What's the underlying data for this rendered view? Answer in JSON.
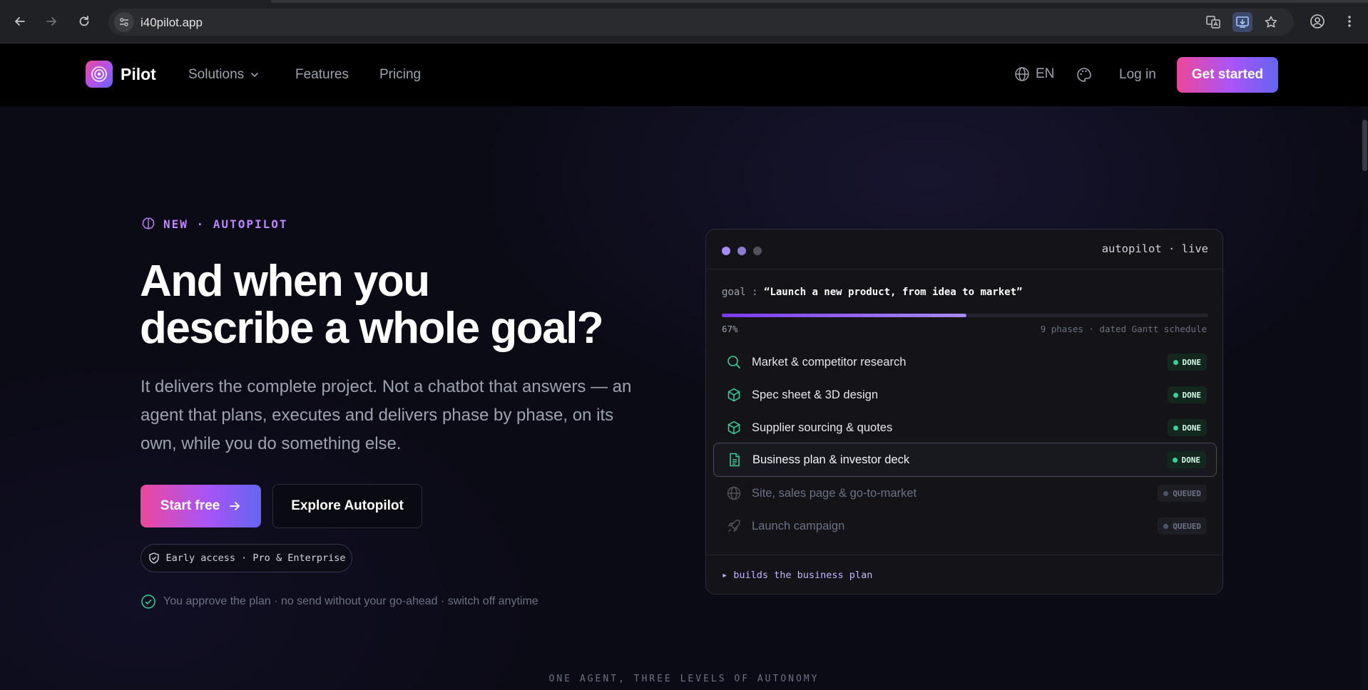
{
  "browser": {
    "url": "i40pilot.app"
  },
  "header": {
    "brand": "Pilot",
    "nav": [
      {
        "label": "Solutions"
      },
      {
        "label": "Features"
      },
      {
        "label": "Pricing"
      }
    ],
    "language": "EN",
    "login": "Log in",
    "cta": "Get started"
  },
  "hero": {
    "badge": "NEW · AUTOPILOT",
    "headline_line1": "And when you",
    "headline_line2": "describe a whole goal?",
    "subtext": "It delivers the complete project. Not a chatbot that answers — an agent that plans, executes and delivers phase by phase, on its own, while you do something else.",
    "primary_button": "Start free",
    "secondary_button": "Explore Autopilot",
    "access_pill": "Early access · Pro & Enterprise",
    "approve_note": "You approve the plan · no send without your go-ahead · switch off anytime",
    "levels_heading": "ONE AGENT, THREE LEVELS OF AUTONOMY"
  },
  "panel": {
    "status": "autopilot · live",
    "goal_label": "goal :",
    "goal_text": "“Launch a new product, from idea to market”",
    "progress_percent": 67,
    "progress_label": "67%",
    "progress_meta": "9 phases · dated Gantt schedule",
    "tasks": [
      {
        "label": "Market & competitor research",
        "status": "DONE",
        "icon": "search-icon"
      },
      {
        "label": "Spec sheet & 3D design",
        "status": "DONE",
        "icon": "cube-icon"
      },
      {
        "label": "Supplier sourcing & quotes",
        "status": "DONE",
        "icon": "cube-icon"
      },
      {
        "label": "Business plan & investor deck",
        "status": "DONE",
        "icon": "document-icon"
      },
      {
        "label": "Site, sales page & go-to-market",
        "status": "QUEUED",
        "icon": "globe-icon"
      },
      {
        "label": "Launch campaign",
        "status": "QUEUED",
        "icon": "rocket-icon"
      }
    ],
    "footer": "▸ builds the business plan"
  },
  "colors": {
    "accent_pink": "#ec4899",
    "accent_purple": "#a855f7",
    "accent_indigo": "#6366f1",
    "done_green": "#34d399"
  }
}
